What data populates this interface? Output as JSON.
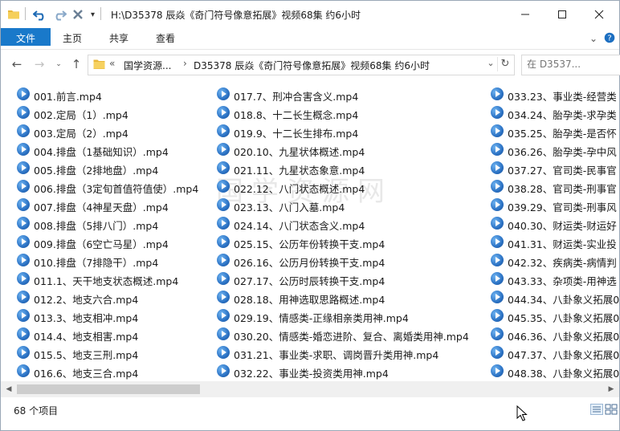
{
  "window": {
    "title": "H:\\D35378 辰焱《奇门符号像意拓展》视频68集 约6小时"
  },
  "ribbon": {
    "tabs": [
      "文件",
      "主页",
      "共享",
      "查看"
    ]
  },
  "address": {
    "crumbs": [
      "国学资源...",
      "D35378 辰焱《奇门符号像意拓展》视频68集 约6小时"
    ],
    "overflow": "«"
  },
  "search": {
    "placeholder": "在 D3537..."
  },
  "watermark": "国学资源网",
  "files": {
    "col1": [
      "001.前言.mp4",
      "002.定局（1）.mp4",
      "003.定局（2）.mp4",
      "004.排盘（1基础知识）.mp4",
      "005.排盘（2排地盘）.mp4",
      "006.排盘（3定旬首值符值使）.mp4",
      "007.排盘（4神星天盘）.mp4",
      "008.排盘（5排八门）.mp4",
      "009.排盘（6空亡马星）.mp4",
      "010.排盘（7排隐干）.mp4",
      "011.1、天干地支状态概述.mp4",
      "012.2、地支六合.mp4",
      "013.3、地支相冲.mp4",
      "014.4、地支相害.mp4",
      "015.5、地支三刑.mp4",
      "016.6、地支三合.mp4"
    ],
    "col2": [
      "017.7、刑冲合害含义.mp4",
      "018.8、十二长生概念.mp4",
      "019.9、十二长生排布.mp4",
      "020.10、九星状体概述.mp4",
      "021.11、九星状态象意.mp4",
      "022.12、八门状态概述.mp4",
      "023.13、八门入墓.mp4",
      "024.14、八门状态含义.mp4",
      "025.15、公历年份转换干支.mp4",
      "026.16、公历月份转换干支.mp4",
      "027.17、公历时辰转换干支.mp4",
      "028.18、用神选取思路概述.mp4",
      "029.19、情感类-正缘相亲类用神.mp4",
      "030.20、情感类-婚恋进阶、复合、离婚类用神.mp4",
      "031.21、事业类-求职、调岗晋升类用神.mp4",
      "032.22、事业类-投资类用神.mp4"
    ],
    "col3": [
      "033.23、事业类-经营类",
      "034.24、胎孕类-求孕类",
      "035.25、胎孕类-是否怀",
      "036.26、胎孕类-孕中风",
      "037.27、官司类-民事官",
      "038.28、官司类-刑事官",
      "039.29、官司类-刑事风",
      "040.30、财运类-财运好",
      "041.31、财运类-实业投",
      "042.32、疾病类-病情判",
      "043.33、杂项类-用神选",
      "044.34、八卦象义拓展0",
      "045.35、八卦象义拓展0",
      "046.36、八卦象义拓展0",
      "047.37、八卦象义拓展0",
      "048.38、八卦象义拓展0"
    ]
  },
  "status": {
    "item_count": "68 个项目"
  }
}
